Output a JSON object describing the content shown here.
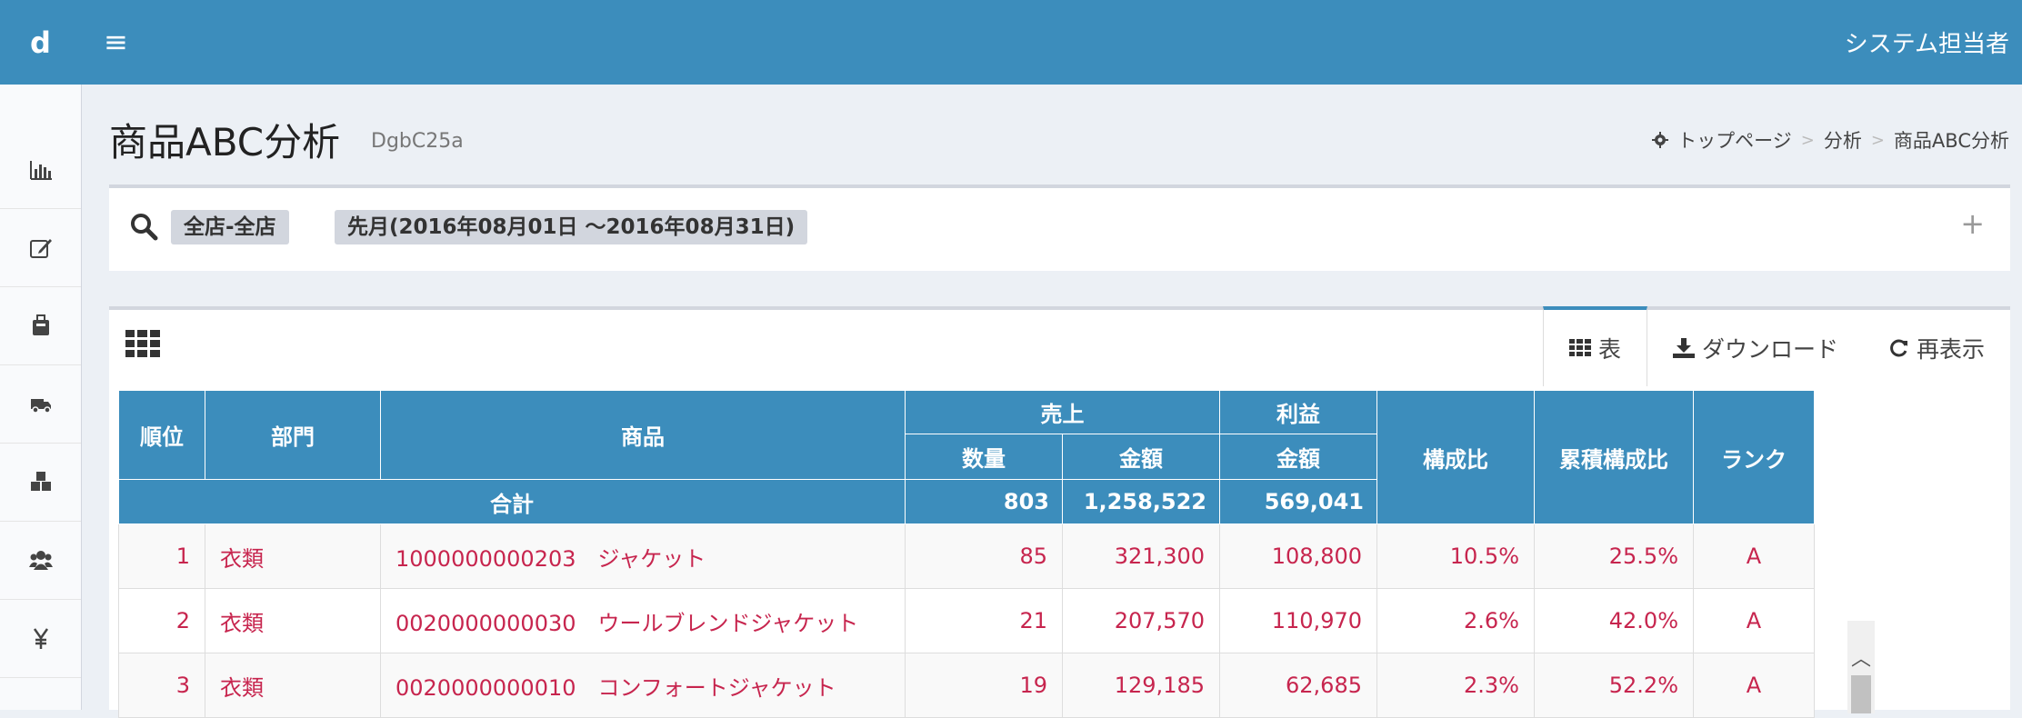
{
  "header": {
    "logo": "d",
    "user": "システム担当者"
  },
  "sidebar": {
    "items": [
      {
        "icon": "bar-chart-icon"
      },
      {
        "icon": "edit-icon"
      },
      {
        "icon": "briefcase-icon"
      },
      {
        "icon": "truck-icon"
      },
      {
        "icon": "cubes-icon"
      },
      {
        "icon": "users-icon"
      },
      {
        "icon": "yen-icon"
      }
    ]
  },
  "page": {
    "title": "商品ABC分析",
    "subtitle": "DgbC25a"
  },
  "breadcrumb": {
    "home": "トップページ",
    "section": "分析",
    "current": "商品ABC分析",
    "separator": ">"
  },
  "search": {
    "chips": [
      "全店-全店",
      "先月(2016年08月01日 ～2016年08月31日)"
    ],
    "expand": "+"
  },
  "panel": {
    "tabs": {
      "table": "表",
      "download": "ダウンロード",
      "reload": "再表示"
    }
  },
  "table": {
    "headers": {
      "rank": "順位",
      "dept": "部門",
      "product": "商品",
      "sales": "売上",
      "profit": "利益",
      "qty": "数量",
      "amount": "金額",
      "profit_amount": "金額",
      "ratio": "構成比",
      "cum_ratio": "累積構成比",
      "class": "ランク"
    },
    "total": {
      "label": "合計",
      "qty": "803",
      "amount": "1,258,522",
      "profit": "569,041"
    },
    "rows": [
      {
        "rank": "1",
        "dept": "衣類",
        "product": "1000000000203　ジャケット",
        "qty": "85",
        "amount": "321,300",
        "profit": "108,800",
        "ratio": "10.5%",
        "cum": "25.5%",
        "class": "A"
      },
      {
        "rank": "2",
        "dept": "衣類",
        "product": "0020000000030　ウールブレンドジャケット",
        "qty": "21",
        "amount": "207,570",
        "profit": "110,970",
        "ratio": "2.6%",
        "cum": "42.0%",
        "class": "A"
      },
      {
        "rank": "3",
        "dept": "衣類",
        "product": "0020000000010　コンフォートジャケット",
        "qty": "19",
        "amount": "129,185",
        "profit": "62,685",
        "ratio": "2.3%",
        "cum": "52.2%",
        "class": "A"
      }
    ]
  },
  "colors": {
    "brand": "#3c8dbc",
    "link": "#c7254e"
  }
}
